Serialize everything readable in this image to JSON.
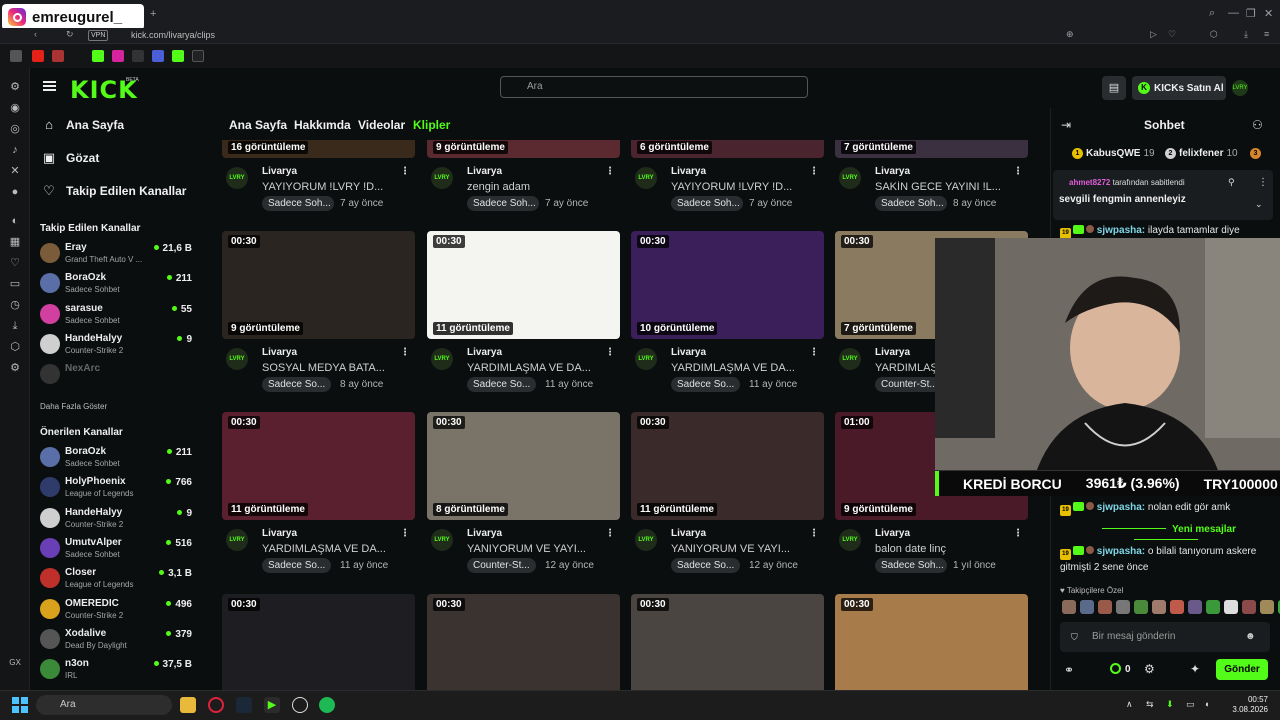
{
  "overlay": {
    "instagram_handle": "emreugurel_"
  },
  "browser": {
    "url": "kick.com/livarya/clips",
    "vpn": "VPN"
  },
  "header": {
    "logo": "KICK",
    "beta": "BETA",
    "search_placeholder": "Ara",
    "kicks_button": "KICKs Satın Al",
    "user_avatar": "LVRY"
  },
  "sidebar": {
    "nav": [
      {
        "label": "Ana Sayfa",
        "icon": "home-icon"
      },
      {
        "label": "Gözat",
        "icon": "browse-icon"
      },
      {
        "label": "Takip Edilen Kanallar",
        "icon": "heart-icon"
      }
    ],
    "following_title": "Takip Edilen Kanallar",
    "following": [
      {
        "name": "Eray",
        "game": "Grand Theft Auto V ...",
        "viewers": "21,6 B",
        "color": "#7a5c3a"
      },
      {
        "name": "BoraOzk",
        "game": "Sadece Sohbet",
        "viewers": "211",
        "color": "#5a6fa8"
      },
      {
        "name": "sarasue",
        "game": "Sadece Sohbet",
        "viewers": "55",
        "color": "#d13fa0"
      },
      {
        "name": "HandeHalyy",
        "game": "Counter-Strike 2",
        "viewers": "9",
        "color": "#cfcfcf"
      },
      {
        "name": "NexArc",
        "game": "",
        "viewers": "",
        "color": "#333"
      }
    ],
    "show_more": "Daha Fazla Göster",
    "recommended_title": "Önerilen Kanallar",
    "recommended": [
      {
        "name": "BoraOzk",
        "game": "Sadece Sohbet",
        "viewers": "211",
        "color": "#5a6fa8"
      },
      {
        "name": "HolyPhoenix",
        "game": "League of Legends",
        "viewers": "766",
        "color": "#2f3b6b"
      },
      {
        "name": "HandeHalyy",
        "game": "Counter-Strike 2",
        "viewers": "9",
        "color": "#cfcfcf"
      },
      {
        "name": "UmutvAlper",
        "game": "Sadece Sohbet",
        "viewers": "516",
        "color": "#6a3fb5"
      },
      {
        "name": "Closer",
        "game": "League of Legends",
        "viewers": "3,1 B",
        "color": "#c0302a"
      },
      {
        "name": "OMEREDIC",
        "game": "Counter-Strike 2",
        "viewers": "496",
        "color": "#d8a21c"
      },
      {
        "name": "Xodalive",
        "game": "Dead By Daylight",
        "viewers": "379",
        "color": "#555"
      },
      {
        "name": "n3on",
        "game": "IRL",
        "viewers": "37,5 B",
        "color": "#3a8a3a"
      }
    ]
  },
  "tabs": [
    {
      "label": "Ana Sayfa",
      "active": false
    },
    {
      "label": "Hakkımda",
      "active": false
    },
    {
      "label": "Videolar",
      "active": false
    },
    {
      "label": "Klipler",
      "active": true
    }
  ],
  "clips": [
    {
      "views": "16 görüntüleme",
      "duration": "",
      "channel": "Livarya",
      "title": "YAYIYORUM !LVRY !D...",
      "category": "Sadece Soh...",
      "age": "7 ay önce",
      "thumb": "#3a2a1c"
    },
    {
      "views": "9 görüntüleme",
      "duration": "",
      "channel": "Livarya",
      "title": "zengin adam",
      "category": "Sadece Soh...",
      "age": "7 ay önce",
      "thumb": "#5a2a30"
    },
    {
      "views": "6 görüntüleme",
      "duration": "",
      "channel": "Livarya",
      "title": "YAYIYORUM !LVRY !D...",
      "category": "Sadece Soh...",
      "age": "7 ay önce",
      "thumb": "#4a2530"
    },
    {
      "views": "7 görüntüleme",
      "duration": "",
      "channel": "Livarya",
      "title": "SAKİN GECE YAYINI !L...",
      "category": "Sadece Soh...",
      "age": "8 ay önce",
      "thumb": "#3a3040"
    },
    {
      "views": "9 görüntüleme",
      "duration": "00:30",
      "channel": "Livarya",
      "title": "SOSYAL MEDYA BATA...",
      "category": "Sadece So...",
      "age": "8 ay önce",
      "thumb": "#2a2520"
    },
    {
      "views": "11 görüntüleme",
      "duration": "00:30",
      "channel": "Livarya",
      "title": "YARDIMLAŞMA VE DA...",
      "category": "Sadece So...",
      "age": "11 ay önce",
      "thumb": "#f4f4f0"
    },
    {
      "views": "10 görüntüleme",
      "duration": "00:30",
      "channel": "Livarya",
      "title": "YARDIMLAŞMA VE DA...",
      "category": "Sadece So...",
      "age": "11 ay önce",
      "thumb": "#3b1f5a"
    },
    {
      "views": "7 görüntüleme",
      "duration": "00:30",
      "channel": "Livarya",
      "title": "YARDIMLAŞMA VE DA...",
      "category": "Counter-St...",
      "age": "11 ay önce",
      "thumb": "#8a7a60"
    },
    {
      "views": "11 görüntüleme",
      "duration": "00:30",
      "channel": "Livarya",
      "title": "YARDIMLAŞMA VE DA...",
      "category": "Sadece So...",
      "age": "11 ay önce",
      "thumb": "#5a2030"
    },
    {
      "views": "8 görüntüleme",
      "duration": "00:30",
      "channel": "Livarya",
      "title": "YANIYORUM VE YAYI...",
      "category": "Counter-St...",
      "age": "12 ay önce",
      "thumb": "#7a7468"
    },
    {
      "views": "11 görüntüleme",
      "duration": "00:30",
      "channel": "Livarya",
      "title": "YANIYORUM VE YAYI...",
      "category": "Sadece So...",
      "age": "12 ay önce",
      "thumb": "#3a2a2a"
    },
    {
      "views": "9 görüntüleme",
      "duration": "01:00",
      "channel": "Livarya",
      "title": "balon date linç",
      "category": "Sadece Soh...",
      "age": "1 yıl önce",
      "thumb": "#4a1a28"
    },
    {
      "views": "",
      "duration": "00:30",
      "channel": "",
      "title": "",
      "category": "",
      "age": "",
      "thumb": "#1e1e22"
    },
    {
      "views": "",
      "duration": "00:30",
      "channel": "",
      "title": "",
      "category": "",
      "age": "",
      "thumb": "#3a3330"
    },
    {
      "views": "",
      "duration": "00:30",
      "channel": "",
      "title": "",
      "category": "",
      "age": "",
      "thumb": "#4a4540"
    },
    {
      "views": "",
      "duration": "00:30",
      "channel": "",
      "title": "",
      "category": "",
      "age": "",
      "thumb": "#a87c4a"
    }
  ],
  "chat": {
    "title": "Sohbet",
    "gifters": [
      {
        "name": "KabusQWE",
        "count": "19",
        "color": "#e7c000",
        "rank": "1"
      },
      {
        "name": "felixfener",
        "count": "10",
        "color": "#cfcfcf",
        "rank": "2"
      },
      {
        "name": "",
        "count": "",
        "color": "#d8862c",
        "rank": "3"
      }
    ],
    "pinned_by_user": "ahmet8272",
    "pinned_by_text": "tarafından sabitlendi",
    "pinned_message": "sevgili fengmin annenleyiz",
    "messages": [
      {
        "badge": "19",
        "user": "sjwpasha:",
        "text": "ilayda tamamlar diye"
      },
      {
        "badge": "19",
        "user": "sjwpasha:",
        "text": "nolan edit gör amk"
      },
      {
        "badge": "19",
        "user": "sjwpasha:",
        "text": "o bilali tanıyorum askere gitmişti 2 sene önce"
      }
    ],
    "new_messages": "Yeni mesajlar",
    "emote_label": "Takipçilere Özel",
    "input_placeholder": "Bir mesaj gönderin",
    "points": "0",
    "send": "Gönder"
  },
  "stream_overlay": {
    "ticker_1": "KREDİ BORCU",
    "ticker_2": "3961₺ (3.96%)",
    "ticker_3": "TRY100000"
  },
  "taskbar": {
    "search": "Ara",
    "time": "00:57",
    "date": "3.08.2026"
  }
}
